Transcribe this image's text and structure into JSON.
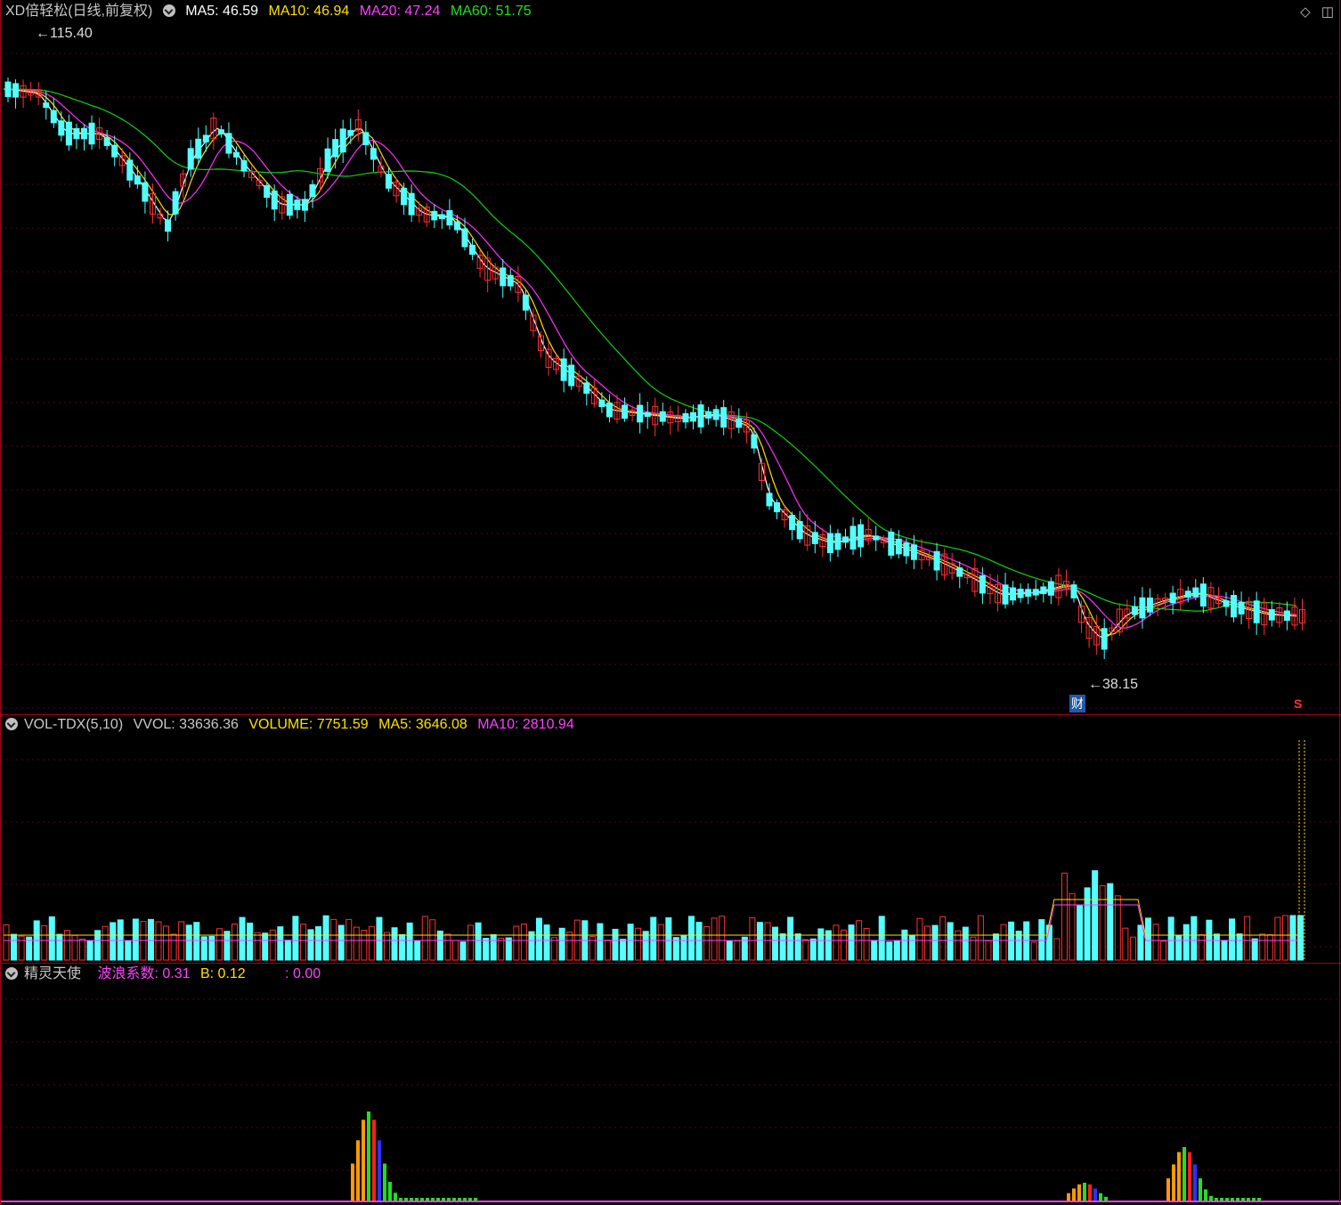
{
  "main": {
    "symbol": "XD倍轻松(日线,前复权)",
    "ma5": "MA5: 46.59",
    "ma10": "MA10: 46.94",
    "ma20": "MA20: 47.24",
    "ma60": "MA60: 51.75",
    "high_label": "115.40",
    "low_label": "38.15",
    "cai_badge": "财",
    "s_marker": "S",
    "colors": {
      "up": "#ff3030",
      "down": "#54ffff",
      "ma5": "#ffffff",
      "ma10": "#ffe000",
      "ma20": "#ff30ff",
      "ma60": "#10d010"
    }
  },
  "volume": {
    "name": "VOL-TDX(5,10)",
    "vvol": "VVOL: 33636.36",
    "volume": "VOLUME: 7751.59",
    "ma5": "MA5: 3646.08",
    "ma10": "MA10: 2810.94"
  },
  "indicator": {
    "name": "精灵天使",
    "wave": "波浪系数: 0.31",
    "b": "B: 0.12",
    "c": ": 0.00"
  },
  "toolbar": {
    "diamond_icon": "◇",
    "restore_icon": "◫"
  },
  "chart_data": {
    "type": "candlestick",
    "title": "XD倍轻松(日线,前复权)",
    "highest": 115.4,
    "lowest": 38.15,
    "ma_latest": {
      "MA5": 46.59,
      "MA10": 46.94,
      "MA20": 47.24,
      "MA60": 51.75
    },
    "volume_latest": {
      "VVOL": 33636.36,
      "VOLUME": 7751.59,
      "MA5": 3646.08,
      "MA10": 2810.94
    },
    "indicator_latest": {
      "波浪系数": 0.31,
      "B": 0.12,
      "C": 0.0
    }
  }
}
